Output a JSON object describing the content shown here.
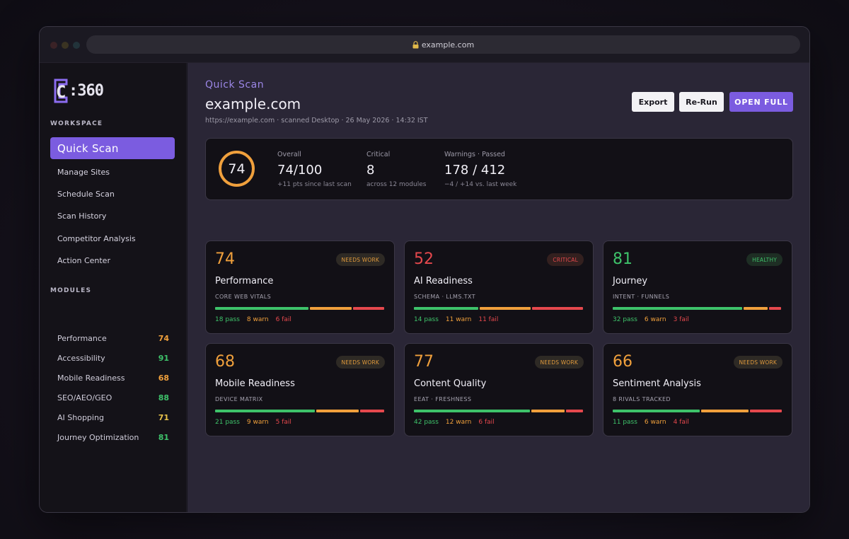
{
  "browser": {
    "url": "example.com"
  },
  "brand": {
    "logo_text": ":360",
    "logo_letter": "C"
  },
  "sidebar": {
    "workspace_label": "WORKSPACE",
    "items": [
      {
        "label": "Quick Scan",
        "active": true
      },
      {
        "label": "Manage Sites"
      },
      {
        "label": "Schedule Scan"
      },
      {
        "label": "Scan History"
      },
      {
        "label": "Competitor Analysis"
      },
      {
        "label": "Action Center"
      }
    ],
    "modules_label": "MODULES",
    "modules": [
      {
        "label": "Performance",
        "score": "74",
        "color": "#f0a03c"
      },
      {
        "label": "Accessibility",
        "score": "91",
        "color": "#3ec26a"
      },
      {
        "label": "Mobile Readiness",
        "score": "68",
        "color": "#f0a03c"
      },
      {
        "label": "SEO/AEO/GEO",
        "score": "88",
        "color": "#3ec26a"
      },
      {
        "label": "AI Shopping",
        "score": "71",
        "color": "#e8c24a"
      },
      {
        "label": "Journey Optimization",
        "score": "81",
        "color": "#3ec26a"
      }
    ]
  },
  "header": {
    "breadcrumb": "Quick Scan",
    "title": "example.com",
    "meta": "https://example.com · scanned Desktop · 26 May 2026 · 14:32 IST",
    "export_label": "Export",
    "rerun_label": "Re-Run",
    "open_label": "OPEN FULL"
  },
  "summary": {
    "score": "74",
    "score_fraction": 0.74,
    "overall_label": "Overall",
    "overall_value": "74/100",
    "overall_sub": "+11 pts since last scan",
    "critical_label": "Critical",
    "critical_value": "8",
    "critical_sub": "across 12 modules",
    "warn_label": "Warnings · Passed",
    "warn_value": "178 / 412",
    "warn_sub": "−4 / +14 vs. last week"
  },
  "cards": [
    {
      "score": "74",
      "color": "#f0a03c",
      "badge": "NEEDS WORK",
      "badge_type": "warn",
      "title": "Performance",
      "sub": "CORE WEB VITALS",
      "pass": 18,
      "warn": 8,
      "fail": 6,
      "pass_label": "18 pass",
      "warn_label": "8 warn",
      "fail_label": "6 fail"
    },
    {
      "score": "52",
      "color": "#e5484d",
      "badge": "CRITICAL",
      "badge_type": "crit",
      "title": "AI Readiness",
      "sub": "SCHEMA · LLMS.TXT",
      "pass": 14,
      "warn": 11,
      "fail": 11,
      "pass_label": "14 pass",
      "warn_label": "11 warn",
      "fail_label": "11 fail"
    },
    {
      "score": "81",
      "color": "#3ec26a",
      "badge": "HEALTHY",
      "badge_type": "ok",
      "title": "Journey",
      "sub": "INTENT · FUNNELS",
      "pass": 32,
      "warn": 6,
      "fail": 3,
      "pass_label": "32 pass",
      "warn_label": "6 warn",
      "fail_label": "3 fail"
    },
    {
      "score": "68",
      "color": "#f0a03c",
      "badge": "NEEDS WORK",
      "badge_type": "warn",
      "title": "Mobile Readiness",
      "sub": "DEVICE MATRIX",
      "pass": 21,
      "warn": 9,
      "fail": 5,
      "pass_label": "21 pass",
      "warn_label": "9 warn",
      "fail_label": "5 fail"
    },
    {
      "score": "77",
      "color": "#f0a03c",
      "badge": "NEEDS WORK",
      "badge_type": "warn",
      "title": "Content Quality",
      "sub": "EEAT · FRESHNESS",
      "pass": 42,
      "warn": 12,
      "fail": 6,
      "pass_label": "42 pass",
      "warn_label": "12 warn",
      "fail_label": "6 fail"
    },
    {
      "score": "66",
      "color": "#f0a03c",
      "badge": "NEEDS WORK",
      "badge_type": "warn",
      "title": "Sentiment Analysis",
      "sub": "8 RIVALS TRACKED",
      "pass": 11,
      "warn": 6,
      "fail": 4,
      "pass_label": "11 pass",
      "warn_label": "6 warn",
      "fail_label": "4 fail"
    }
  ],
  "colors": {
    "accent": "#7b5ce0",
    "pass": "#3ec26a",
    "warn": "#f0a03c",
    "fail": "#e5484d"
  }
}
